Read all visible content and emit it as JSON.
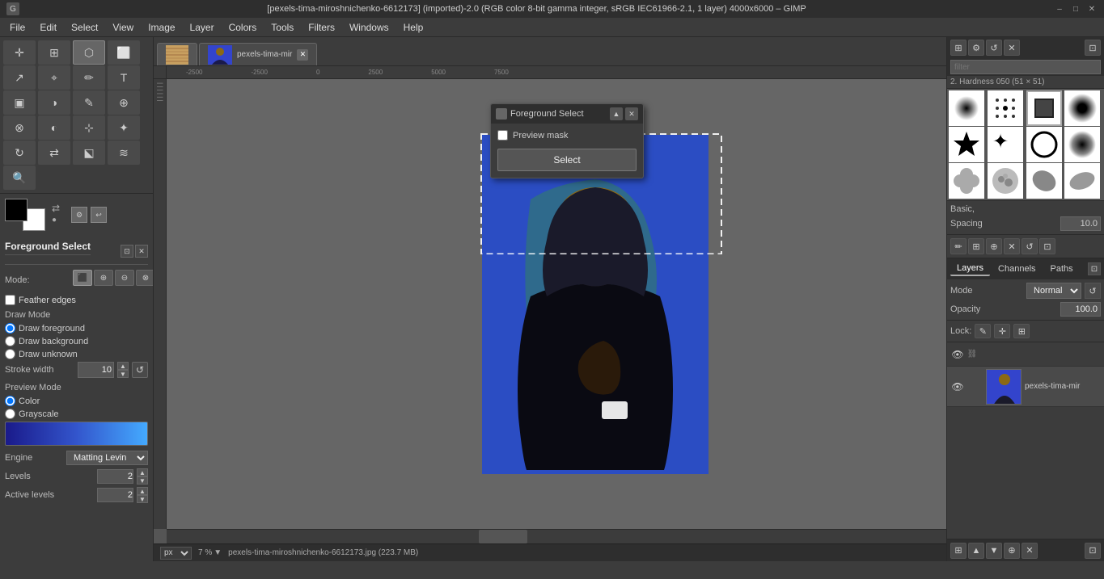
{
  "titlebar": {
    "title": "[pexels-tima-miroshnichenko-6612173] (imported)-2.0 (RGB color 8-bit gamma integer, sRGB IEC61966-2.1, 1 layer) 4000x6000 – GIMP",
    "minimize": "–",
    "maximize": "□",
    "close": "✕"
  },
  "menubar": {
    "items": [
      "File",
      "Edit",
      "Select",
      "View",
      "Image",
      "Layer",
      "Colors",
      "Tools",
      "Filters",
      "Windows",
      "Help"
    ]
  },
  "toolbox": {
    "tools": [
      {
        "name": "move-tool",
        "icon": "✛"
      },
      {
        "name": "align-tool",
        "icon": "⊞"
      },
      {
        "name": "free-select-tool",
        "icon": "⬡"
      },
      {
        "name": "transform-tool",
        "icon": "⬜"
      },
      {
        "name": "scale-tool",
        "icon": "↗"
      },
      {
        "name": "crop-tool",
        "icon": "⌖"
      },
      {
        "name": "path-tool",
        "icon": "✏"
      },
      {
        "name": "text-tool",
        "icon": "T"
      },
      {
        "name": "bucket-fill",
        "icon": "▣"
      },
      {
        "name": "blend-tool",
        "icon": "◑"
      },
      {
        "name": "pencil-tool",
        "icon": "✎"
      },
      {
        "name": "clone-tool",
        "icon": "⊕"
      },
      {
        "name": "heal-tool",
        "icon": "⊗"
      },
      {
        "name": "dodge-burn",
        "icon": "◐"
      },
      {
        "name": "fuzzy-select",
        "icon": "⊹"
      },
      {
        "name": "color-picker",
        "icon": "✦"
      },
      {
        "name": "rotate-tool",
        "icon": "↻"
      },
      {
        "name": "flip-tool",
        "icon": "⇄"
      },
      {
        "name": "perspective-tool",
        "icon": "⬕"
      },
      {
        "name": "smudge-tool",
        "icon": "≋"
      },
      {
        "name": "zoom-tool",
        "icon": "🔍"
      }
    ],
    "fg_color": "#000000",
    "bg_color": "#ffffff",
    "tool_options": {
      "title": "Foreground Select",
      "mode_label": "Mode:",
      "feather_edges": "Feather edges",
      "feather_checked": false,
      "draw_mode_label": "Draw Mode",
      "draw_foreground": "Draw foreground",
      "draw_background": "Draw background",
      "draw_unknown": "Draw unknown",
      "draw_selected": "foreground",
      "stroke_width_label": "Stroke width",
      "stroke_width_value": "10",
      "preview_mode_label": "Preview Mode",
      "color_option": "Color",
      "grayscale_option": "Grayscale",
      "preview_selected": "color",
      "engine_label": "Engine",
      "engine_value": "Matting Levin",
      "levels_label": "Levels",
      "levels_value": "2",
      "active_levels_label": "Active levels",
      "active_levels_value": "2"
    }
  },
  "tabs": [
    {
      "name": "tab-wood",
      "label": ""
    },
    {
      "name": "tab-person",
      "label": "pexels-tima-mir",
      "active": true
    },
    {
      "name": "tab-close",
      "label": "✕"
    }
  ],
  "canvas": {
    "ruler_marks": [
      "-2500",
      "-2500",
      "0",
      "2500",
      "5000",
      "7500"
    ],
    "zoom_label": "7 %",
    "file_name": "pexels-tima-miroshnichenko-6612173.jpg (223.7 MB)",
    "unit": "px"
  },
  "fg_dialog": {
    "title": "Foreground Select",
    "preview_mask_label": "Preview mask",
    "preview_mask_checked": false,
    "select_button": "Select",
    "icon": "🖌"
  },
  "brushes_panel": {
    "filter_placeholder": "filter",
    "hardness_label": "2. Hardness 050 (51 × 51)",
    "brushes": [
      {
        "name": "brush-1",
        "type": "gradient"
      },
      {
        "name": "brush-2",
        "type": "dots"
      },
      {
        "name": "brush-3",
        "type": "square"
      },
      {
        "name": "brush-4",
        "type": "circle_large"
      },
      {
        "name": "brush-5",
        "type": "star"
      },
      {
        "name": "brush-6",
        "type": "texture1"
      },
      {
        "name": "brush-7",
        "type": "circle_stroke"
      },
      {
        "name": "brush-8",
        "type": "circle_medium"
      },
      {
        "name": "brush-9",
        "type": "texture2"
      },
      {
        "name": "brush-10",
        "type": "texture3"
      },
      {
        "name": "brush-11",
        "type": "blob1"
      },
      {
        "name": "brush-12",
        "type": "blob2"
      }
    ],
    "basic_label": "Basic,",
    "spacing_label": "Spacing",
    "spacing_value": "10.0"
  },
  "layers_panel": {
    "tabs": [
      "Layers",
      "Channels",
      "Paths"
    ],
    "active_tab": "Layers",
    "mode_label": "Mode",
    "mode_value": "Normal",
    "opacity_label": "Opacity",
    "opacity_value": "100.0",
    "lock_label": "Lock:",
    "layers": [
      {
        "name": "pexels-tima-mir",
        "visible": true,
        "active": true
      }
    ]
  },
  "statusbar": {
    "unit": "px",
    "zoom": "7 %",
    "file_info": "pexels-tima-miroshnichenko-6612173.jpg (223.7 MB)"
  }
}
